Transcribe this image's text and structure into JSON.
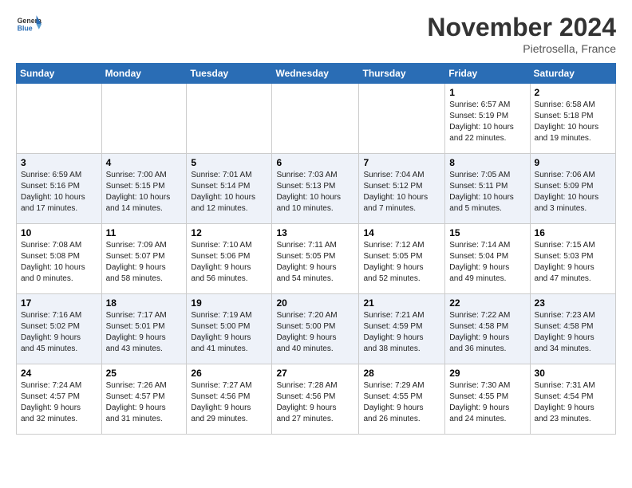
{
  "header": {
    "logo_line1": "General",
    "logo_line2": "Blue",
    "month": "November 2024",
    "location": "Pietrosella, France"
  },
  "weekdays": [
    "Sunday",
    "Monday",
    "Tuesday",
    "Wednesday",
    "Thursday",
    "Friday",
    "Saturday"
  ],
  "weeks": [
    [
      {
        "day": "",
        "info": ""
      },
      {
        "day": "",
        "info": ""
      },
      {
        "day": "",
        "info": ""
      },
      {
        "day": "",
        "info": ""
      },
      {
        "day": "",
        "info": ""
      },
      {
        "day": "1",
        "info": "Sunrise: 6:57 AM\nSunset: 5:19 PM\nDaylight: 10 hours\nand 22 minutes."
      },
      {
        "day": "2",
        "info": "Sunrise: 6:58 AM\nSunset: 5:18 PM\nDaylight: 10 hours\nand 19 minutes."
      }
    ],
    [
      {
        "day": "3",
        "info": "Sunrise: 6:59 AM\nSunset: 5:16 PM\nDaylight: 10 hours\nand 17 minutes."
      },
      {
        "day": "4",
        "info": "Sunrise: 7:00 AM\nSunset: 5:15 PM\nDaylight: 10 hours\nand 14 minutes."
      },
      {
        "day": "5",
        "info": "Sunrise: 7:01 AM\nSunset: 5:14 PM\nDaylight: 10 hours\nand 12 minutes."
      },
      {
        "day": "6",
        "info": "Sunrise: 7:03 AM\nSunset: 5:13 PM\nDaylight: 10 hours\nand 10 minutes."
      },
      {
        "day": "7",
        "info": "Sunrise: 7:04 AM\nSunset: 5:12 PM\nDaylight: 10 hours\nand 7 minutes."
      },
      {
        "day": "8",
        "info": "Sunrise: 7:05 AM\nSunset: 5:11 PM\nDaylight: 10 hours\nand 5 minutes."
      },
      {
        "day": "9",
        "info": "Sunrise: 7:06 AM\nSunset: 5:09 PM\nDaylight: 10 hours\nand 3 minutes."
      }
    ],
    [
      {
        "day": "10",
        "info": "Sunrise: 7:08 AM\nSunset: 5:08 PM\nDaylight: 10 hours\nand 0 minutes."
      },
      {
        "day": "11",
        "info": "Sunrise: 7:09 AM\nSunset: 5:07 PM\nDaylight: 9 hours\nand 58 minutes."
      },
      {
        "day": "12",
        "info": "Sunrise: 7:10 AM\nSunset: 5:06 PM\nDaylight: 9 hours\nand 56 minutes."
      },
      {
        "day": "13",
        "info": "Sunrise: 7:11 AM\nSunset: 5:05 PM\nDaylight: 9 hours\nand 54 minutes."
      },
      {
        "day": "14",
        "info": "Sunrise: 7:12 AM\nSunset: 5:05 PM\nDaylight: 9 hours\nand 52 minutes."
      },
      {
        "day": "15",
        "info": "Sunrise: 7:14 AM\nSunset: 5:04 PM\nDaylight: 9 hours\nand 49 minutes."
      },
      {
        "day": "16",
        "info": "Sunrise: 7:15 AM\nSunset: 5:03 PM\nDaylight: 9 hours\nand 47 minutes."
      }
    ],
    [
      {
        "day": "17",
        "info": "Sunrise: 7:16 AM\nSunset: 5:02 PM\nDaylight: 9 hours\nand 45 minutes."
      },
      {
        "day": "18",
        "info": "Sunrise: 7:17 AM\nSunset: 5:01 PM\nDaylight: 9 hours\nand 43 minutes."
      },
      {
        "day": "19",
        "info": "Sunrise: 7:19 AM\nSunset: 5:00 PM\nDaylight: 9 hours\nand 41 minutes."
      },
      {
        "day": "20",
        "info": "Sunrise: 7:20 AM\nSunset: 5:00 PM\nDaylight: 9 hours\nand 40 minutes."
      },
      {
        "day": "21",
        "info": "Sunrise: 7:21 AM\nSunset: 4:59 PM\nDaylight: 9 hours\nand 38 minutes."
      },
      {
        "day": "22",
        "info": "Sunrise: 7:22 AM\nSunset: 4:58 PM\nDaylight: 9 hours\nand 36 minutes."
      },
      {
        "day": "23",
        "info": "Sunrise: 7:23 AM\nSunset: 4:58 PM\nDaylight: 9 hours\nand 34 minutes."
      }
    ],
    [
      {
        "day": "24",
        "info": "Sunrise: 7:24 AM\nSunset: 4:57 PM\nDaylight: 9 hours\nand 32 minutes."
      },
      {
        "day": "25",
        "info": "Sunrise: 7:26 AM\nSunset: 4:57 PM\nDaylight: 9 hours\nand 31 minutes."
      },
      {
        "day": "26",
        "info": "Sunrise: 7:27 AM\nSunset: 4:56 PM\nDaylight: 9 hours\nand 29 minutes."
      },
      {
        "day": "27",
        "info": "Sunrise: 7:28 AM\nSunset: 4:56 PM\nDaylight: 9 hours\nand 27 minutes."
      },
      {
        "day": "28",
        "info": "Sunrise: 7:29 AM\nSunset: 4:55 PM\nDaylight: 9 hours\nand 26 minutes."
      },
      {
        "day": "29",
        "info": "Sunrise: 7:30 AM\nSunset: 4:55 PM\nDaylight: 9 hours\nand 24 minutes."
      },
      {
        "day": "30",
        "info": "Sunrise: 7:31 AM\nSunset: 4:54 PM\nDaylight: 9 hours\nand 23 minutes."
      }
    ]
  ]
}
